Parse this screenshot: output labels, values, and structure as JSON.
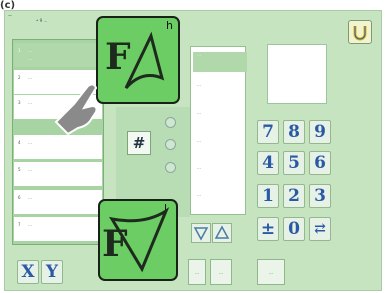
{
  "corner_label": "(c)",
  "screen_label": "—",
  "header_text": "• 9 …",
  "left_list": [
    {
      "index": "1",
      "line1": "…",
      "line2": "…",
      "selected": true
    },
    {
      "index": "2",
      "line1": "…",
      "line2": "…",
      "selected": false
    },
    {
      "index": "3",
      "line1": "…",
      "line2": "…",
      "selected": false
    },
    {
      "index": "4",
      "line1": "…",
      "line2": "…",
      "selected": false
    },
    {
      "index": "5",
      "line1": "…",
      "line2": "…",
      "selected": false
    },
    {
      "index": "6",
      "line1": "…",
      "line2": "…",
      "selected": false
    },
    {
      "index": "7",
      "line1": "…",
      "line2": "…",
      "selected": false
    }
  ],
  "right_list": [
    "…",
    "…",
    "…",
    "…",
    "…",
    "…"
  ],
  "hash_button": "#",
  "keypad": [
    "7",
    "8",
    "9",
    "4",
    "5",
    "6",
    "1",
    "2",
    "3",
    "±",
    "0",
    "⇄"
  ],
  "bottom_left_buttons": [
    "X",
    "Y"
  ],
  "bottom_buttons": [
    "…",
    "…",
    "…"
  ],
  "icon_h": {
    "letter": "F",
    "tag": "h"
  },
  "icon_l": {
    "letter": "F",
    "tag": "l"
  },
  "icon_names": [
    "shape-h-icon",
    "shape-l-icon",
    "hand-pointer-icon",
    "magnet-icon",
    "triangle-down-icon",
    "triangle-up-icon"
  ],
  "colors": {
    "panel": "#c7e4c1",
    "icon_green": "#6bcd63",
    "key_text": "#2b5aa5"
  }
}
